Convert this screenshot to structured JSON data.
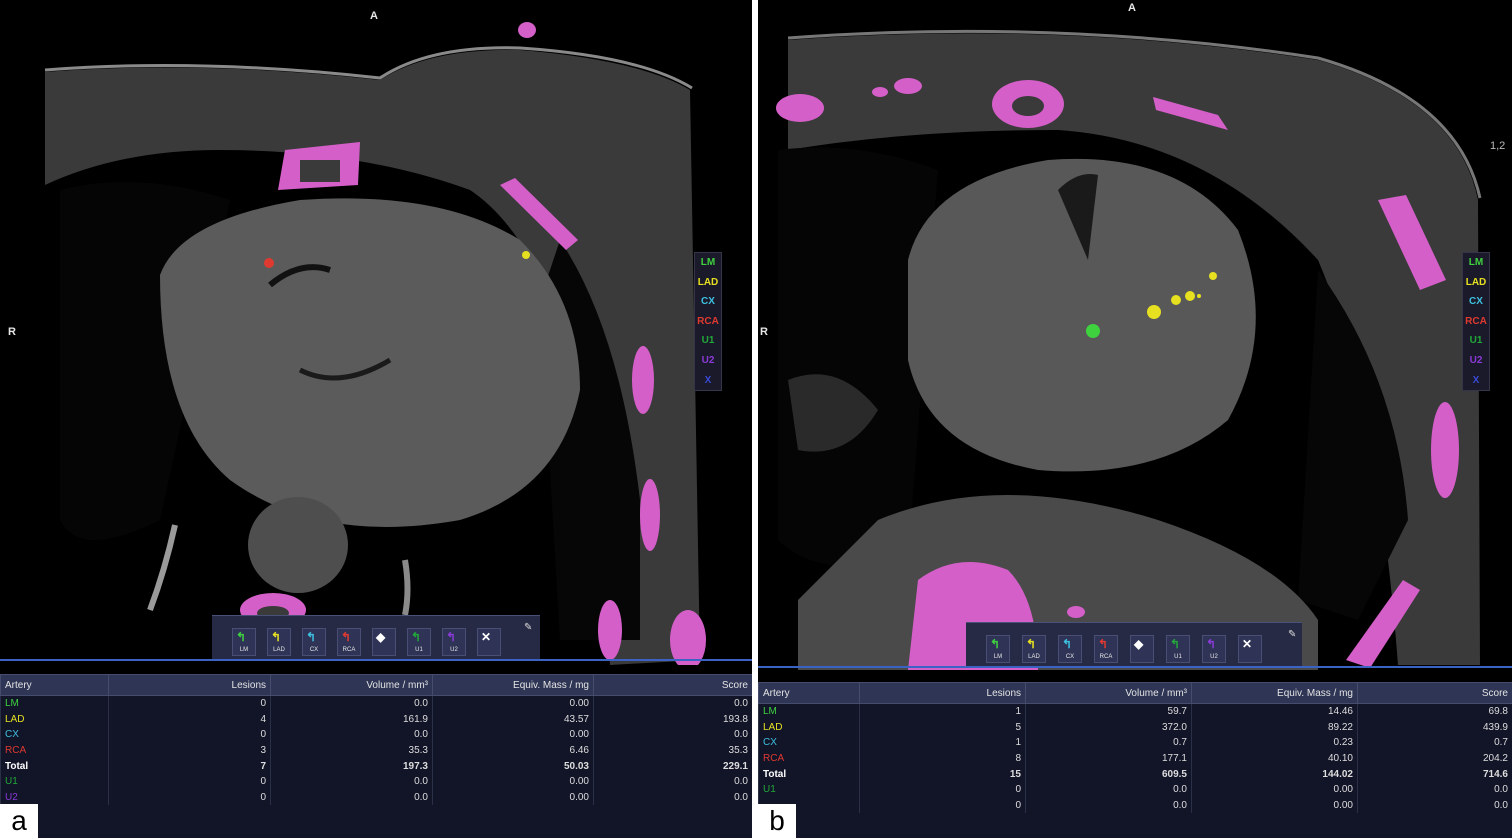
{
  "colors": {
    "calcium_overlay": "#d45fc8",
    "LM": "#3fd23f",
    "LAD": "#e6e020",
    "CX": "#3ec0e0",
    "RCA": "#e03a30",
    "U1": "#22a838",
    "U2": "#8a3ad8",
    "X": "#3a4ad8"
  },
  "legend": [
    {
      "label": "LM",
      "color": "#3fd23f"
    },
    {
      "label": "LAD",
      "color": "#e6e020"
    },
    {
      "label": "CX",
      "color": "#3ec0e0"
    },
    {
      "label": "RCA",
      "color": "#e03a30"
    },
    {
      "label": "U1",
      "color": "#22a838"
    },
    {
      "label": "U2",
      "color": "#8a3ad8"
    },
    {
      "label": "X",
      "color": "#3a4ad8"
    }
  ],
  "toolbar": [
    {
      "label": "LM",
      "icon": "lm-brush-icon",
      "color": "#3fd23f"
    },
    {
      "label": "LAD",
      "icon": "lad-brush-icon",
      "color": "#e6e020"
    },
    {
      "label": "CX",
      "icon": "cx-brush-icon",
      "color": "#3ec0e0"
    },
    {
      "label": "RCA",
      "icon": "rca-brush-icon",
      "color": "#e03a30"
    },
    {
      "label": "",
      "icon": "eraser-icon",
      "color": "#ffffff"
    },
    {
      "label": "U1",
      "icon": "u1-brush-icon",
      "color": "#22a838"
    },
    {
      "label": "U2",
      "icon": "u2-brush-icon",
      "color": "#8a3ad8"
    },
    {
      "label": "",
      "icon": "x-close-icon",
      "color": "#3a4ad8"
    }
  ],
  "panels": [
    {
      "id": "a",
      "label": "a",
      "orientation": {
        "anterior": "A",
        "right": "R"
      },
      "table": {
        "headers": [
          "Artery",
          "Lesions",
          "Volume / mm³",
          "Equiv. Mass / mg",
          "Score"
        ],
        "rows": [
          {
            "artery": "LM",
            "color": "#3fd23f",
            "lesions": "0",
            "volume": "0.0",
            "mass": "0.00",
            "score": "0.0"
          },
          {
            "artery": "LAD",
            "color": "#e6e020",
            "lesions": "4",
            "volume": "161.9",
            "mass": "43.57",
            "score": "193.8"
          },
          {
            "artery": "CX",
            "color": "#3ec0e0",
            "lesions": "0",
            "volume": "0.0",
            "mass": "0.00",
            "score": "0.0"
          },
          {
            "artery": "RCA",
            "color": "#e03a30",
            "lesions": "3",
            "volume": "35.3",
            "mass": "6.46",
            "score": "35.3"
          },
          {
            "artery": "Total",
            "color": "#ffffff",
            "lesions": "7",
            "volume": "197.3",
            "mass": "50.03",
            "score": "229.1",
            "bold": true
          },
          {
            "artery": "U1",
            "color": "#22a838",
            "lesions": "0",
            "volume": "0.0",
            "mass": "0.00",
            "score": "0.0"
          },
          {
            "artery": "U2",
            "color": "#8a3ad8",
            "lesions": "0",
            "volume": "0.0",
            "mass": "0.00",
            "score": "0.0"
          }
        ]
      }
    },
    {
      "id": "b",
      "label": "b",
      "orientation": {
        "anterior": "A",
        "right": "R"
      },
      "series_number": "1,2",
      "table": {
        "headers": [
          "Artery",
          "Lesions",
          "Volume / mm³",
          "Equiv. Mass / mg",
          "Score"
        ],
        "rows": [
          {
            "artery": "LM",
            "color": "#3fd23f",
            "lesions": "1",
            "volume": "59.7",
            "mass": "14.46",
            "score": "69.8"
          },
          {
            "artery": "LAD",
            "color": "#e6e020",
            "lesions": "5",
            "volume": "372.0",
            "mass": "89.22",
            "score": "439.9"
          },
          {
            "artery": "CX",
            "color": "#3ec0e0",
            "lesions": "1",
            "volume": "0.7",
            "mass": "0.23",
            "score": "0.7"
          },
          {
            "artery": "RCA",
            "color": "#e03a30",
            "lesions": "8",
            "volume": "177.1",
            "mass": "40.10",
            "score": "204.2"
          },
          {
            "artery": "Total",
            "color": "#ffffff",
            "lesions": "15",
            "volume": "609.5",
            "mass": "144.02",
            "score": "714.6",
            "bold": true
          },
          {
            "artery": "U1",
            "color": "#22a838",
            "lesions": "0",
            "volume": "0.0",
            "mass": "0.00",
            "score": "0.0"
          },
          {
            "artery": "",
            "color": "#8a3ad8",
            "lesions": "0",
            "volume": "0.0",
            "mass": "0.00",
            "score": "0.0"
          }
        ]
      }
    }
  ]
}
